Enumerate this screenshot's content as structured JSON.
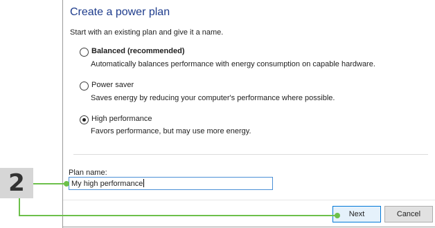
{
  "dialog": {
    "title": "Create a power plan",
    "subtitle": "Start with an existing plan and give it a name.",
    "options": [
      {
        "label": "Balanced (recommended)",
        "description": "Automatically balances performance with energy consumption on capable hardware.",
        "selected": false
      },
      {
        "label": "Power saver",
        "description": "Saves energy by reducing your computer's performance where possible.",
        "selected": false
      },
      {
        "label": "High performance",
        "description": "Favors performance, but may use more energy.",
        "selected": true
      }
    ],
    "plan_name_label": "Plan name:",
    "plan_name_value": "My high performance",
    "next_label": "Next",
    "cancel_label": "Cancel"
  },
  "callout": {
    "step_number": "2",
    "color": "#6cc04a"
  }
}
